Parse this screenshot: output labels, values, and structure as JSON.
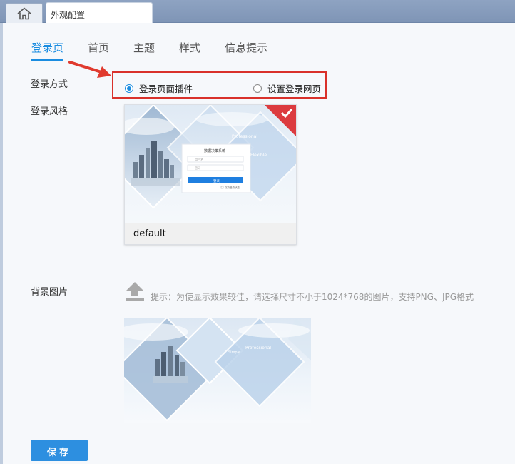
{
  "window": {
    "home_icon": "home-icon",
    "tab_label": "外观配置"
  },
  "subtabs": [
    {
      "label": "登录页",
      "active": true
    },
    {
      "label": "首页",
      "active": false
    },
    {
      "label": "主题",
      "active": false
    },
    {
      "label": "样式",
      "active": false
    },
    {
      "label": "信息提示",
      "active": false
    }
  ],
  "login_mode": {
    "label": "登录方式",
    "options": [
      {
        "label": "登录页面插件",
        "selected": true
      },
      {
        "label": "设置登录网页",
        "selected": false
      }
    ]
  },
  "login_style": {
    "label": "登录风格",
    "selected_style": "default",
    "thumb_text": {
      "system_name": "数据决策系统",
      "username_placeholder": "用户名",
      "password_placeholder": "密码",
      "login_button": "登录",
      "remember": "保持登录状态",
      "watermark_1": "Professional",
      "watermark_2": "Flexible"
    }
  },
  "background": {
    "label": "背景图片",
    "upload_icon": "upload-icon",
    "tip": "提示：为使显示效果较佳，请选择尺寸不小于1024*768的图片，支持PNG、JPG格式",
    "watermark_1": "Professional",
    "watermark_2": "Simple"
  },
  "save_label": "保存",
  "colors": {
    "accent": "#1a8ce0",
    "highlight": "#d9312b",
    "button": "#2d8fe0"
  }
}
